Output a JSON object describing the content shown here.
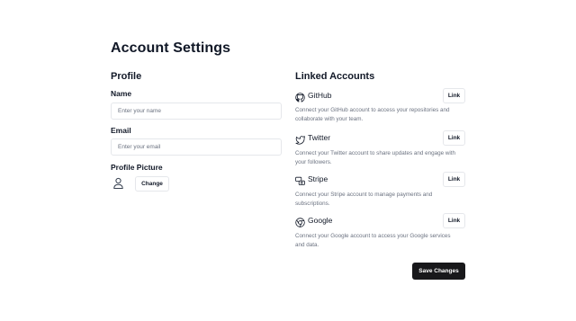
{
  "page": {
    "title": "Account Settings"
  },
  "profile": {
    "section_title": "Profile",
    "name_label": "Name",
    "name_value": "",
    "name_placeholder": "Enter your name",
    "email_label": "Email",
    "email_value": "",
    "email_placeholder": "Enter your email",
    "picture_label": "Profile Picture",
    "avatar_icon": "user-icon",
    "change_label": "Change"
  },
  "linked": {
    "section_title": "Linked Accounts",
    "accounts": [
      {
        "name": "GitHub",
        "icon": "github-icon",
        "description": "Connect your GitHub account to access your repositories and collaborate with your team.",
        "button": "Link"
      },
      {
        "name": "Twitter",
        "icon": "twitter-icon",
        "description": "Connect your Twitter account to share updates and engage with your followers.",
        "button": "Link"
      },
      {
        "name": "Stripe",
        "icon": "stripe-icon",
        "description": "Connect your Stripe account to manage payments and subscriptions.",
        "button": "Link"
      },
      {
        "name": "Google",
        "icon": "google-chrome-icon",
        "description": "Connect your Google account to access your Google services and data.",
        "button": "Link"
      }
    ]
  },
  "actions": {
    "save_label": "Save Changes"
  },
  "colors": {
    "text": "#111827",
    "muted": "#6b7280",
    "border": "#e5e7eb",
    "primary_button": "#18181b"
  }
}
